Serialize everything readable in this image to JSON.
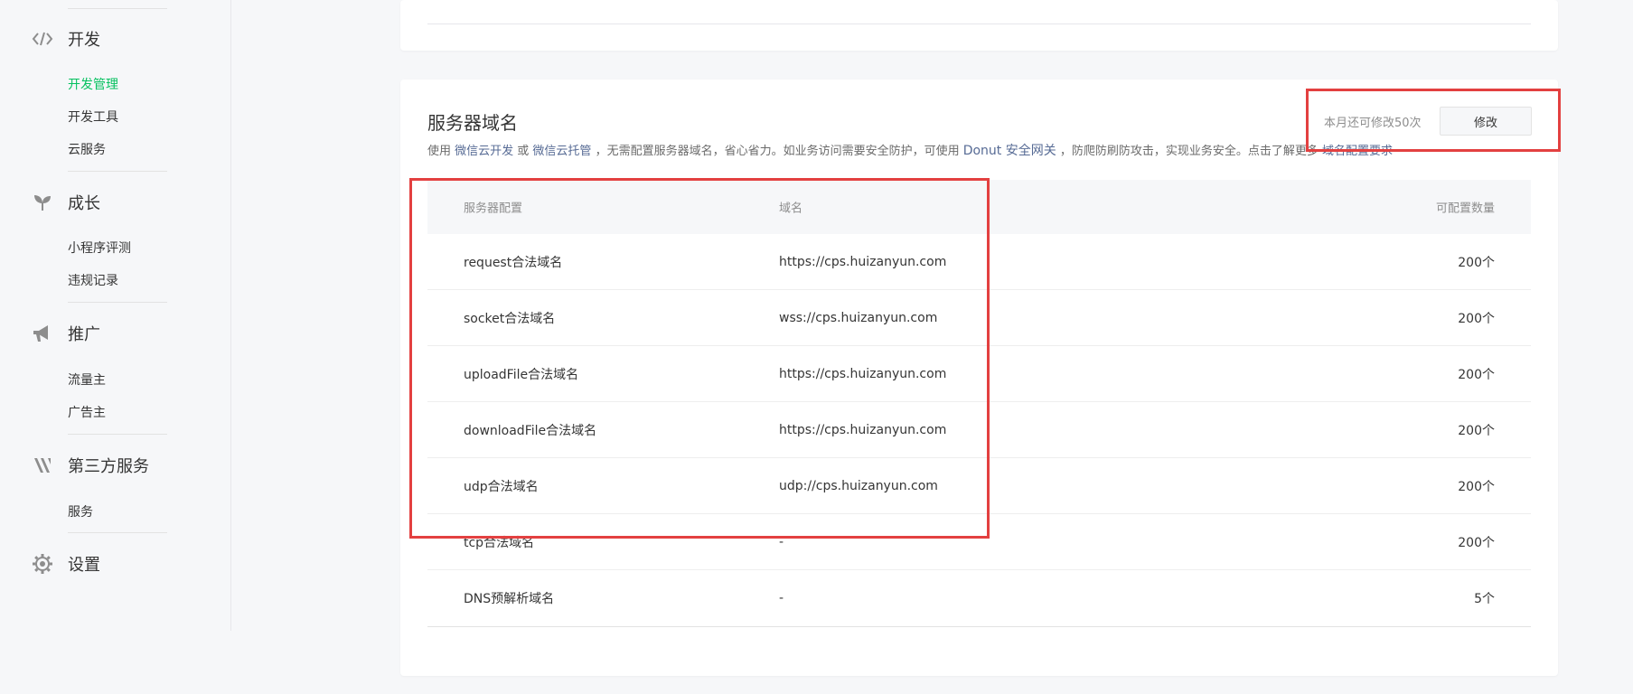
{
  "sidebar": {
    "sections": [
      {
        "label": "开发",
        "icon": "code-icon",
        "items": [
          {
            "label": "开发管理",
            "active": true
          },
          {
            "label": "开发工具",
            "active": false
          },
          {
            "label": "云服务",
            "active": false
          }
        ]
      },
      {
        "label": "成长",
        "icon": "sprout-icon",
        "items": [
          {
            "label": "小程序评测",
            "active": false
          },
          {
            "label": "违规记录",
            "active": false
          }
        ]
      },
      {
        "label": "推广",
        "icon": "megaphone-icon",
        "items": [
          {
            "label": "流量主",
            "active": false
          },
          {
            "label": "广告主",
            "active": false
          }
        ]
      },
      {
        "label": "第三方服务",
        "icon": "third-party-icon",
        "items": [
          {
            "label": "服务",
            "active": false
          }
        ]
      },
      {
        "label": "设置",
        "icon": "gear-icon",
        "items": []
      }
    ]
  },
  "domain_card": {
    "title": "服务器域名",
    "desc": {
      "p1": "使用 ",
      "link1": "微信云开发",
      "p2": " 或 ",
      "link2": "微信云托管",
      "p3": " ，无需配置服务器域名，省心省力。如业务访问需要安全防护，可使用 ",
      "link3": "Donut 安全网关",
      "p4": " ，防爬防刷防攻击，实现业务安全。点击了解更多 ",
      "link4": "域名配置要求"
    },
    "remaining_text": "本月还可修改50次",
    "edit_button": "修改",
    "table": {
      "headers": [
        "服务器配置",
        "域名",
        "可配置数量"
      ],
      "rows": [
        {
          "config": "request合法域名",
          "domain": "https://cps.huizanyun.com",
          "count": "200个"
        },
        {
          "config": "socket合法域名",
          "domain": "wss://cps.huizanyun.com",
          "count": "200个"
        },
        {
          "config": "uploadFile合法域名",
          "domain": "https://cps.huizanyun.com",
          "count": "200个"
        },
        {
          "config": "downloadFile合法域名",
          "domain": "https://cps.huizanyun.com",
          "count": "200个"
        },
        {
          "config": "udp合法域名",
          "domain": "udp://cps.huizanyun.com",
          "count": "200个"
        },
        {
          "config": "tcp合法域名",
          "domain": "-",
          "count": "200个"
        },
        {
          "config": "DNS预解析域名",
          "domain": "-",
          "count": "5个"
        }
      ]
    }
  },
  "colors": {
    "accent_green": "#07c160",
    "link_blue": "#576b95",
    "highlight_red": "#e34040"
  }
}
